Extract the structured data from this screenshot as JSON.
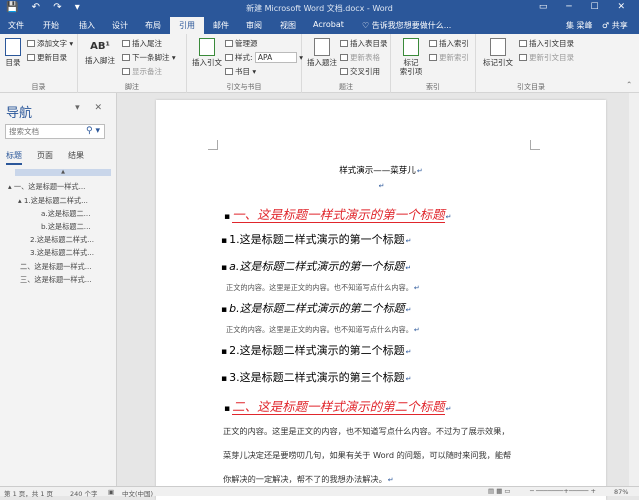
{
  "titlebar": {
    "quick_access": "💾 ↶ ↷ ▾",
    "document_title": "新建 Microsoft Word 文档.docx - Word",
    "window_controls": "▭ ─ ☐ ✕"
  },
  "tabs": [
    {
      "label": "文件"
    },
    {
      "label": "开始"
    },
    {
      "label": "插入"
    },
    {
      "label": "设计"
    },
    {
      "label": "布局"
    },
    {
      "label": "引用"
    },
    {
      "label": "邮件"
    },
    {
      "label": "审阅"
    },
    {
      "label": "视图"
    },
    {
      "label": "Acrobat"
    },
    {
      "label": "♡ 告诉我您想要做什么..."
    },
    {
      "label": "集 梁峰"
    },
    {
      "label": "♂ 共享"
    }
  ],
  "ribbon": {
    "toc": {
      "big": "目录",
      "add_text": "添加文字",
      "update": "更新目录",
      "label": "目录"
    },
    "footnotes": {
      "big": "插入脚注",
      "ab": "AB¹",
      "insert_endnote": "插入尾注",
      "next_footnote": "下一条脚注",
      "show_notes": "显示备注",
      "label": "脚注"
    },
    "citations": {
      "big": "插入引文",
      "manage": "管理源",
      "style_label": "样式:",
      "style_value": "APA",
      "bibliography": "书目",
      "label": "引文与书目"
    },
    "captions": {
      "big": "插入题注",
      "insert_toc_fig": "插入表目录",
      "update_table": "更新表格",
      "cross_ref": "交叉引用",
      "label": "题注"
    },
    "index": {
      "big": "标记\n索引项",
      "insert_index": "插入索引",
      "update_index": "更新索引",
      "label": "索引"
    },
    "authorities": {
      "big": "标记引文",
      "insert_toa": "插入引文目录",
      "update_toa": "更新引文目录",
      "label": "引文目录"
    }
  },
  "nav": {
    "title": "导航",
    "search_placeholder": "搜索文档",
    "tabs": [
      "标题",
      "页面",
      "结果"
    ],
    "items": [
      "▴ 一、这是标题一样式...",
      "▴ 1.这是标题二样式...",
      "a.这是标题二...",
      "b.这是标题二...",
      "2.这是标题二样式...",
      "3.这是标题二样式...",
      "二、这是标题一样式...",
      "三、这是标题一样式..."
    ]
  },
  "doc": {
    "heading": "样式演示——菜芽儿",
    "para_mark": "↵",
    "bullet": "▪",
    "lines": [
      "一、这是标题一样式演示的第一个标题",
      "1.这是标题二样式演示的第一个标题",
      "a.这是标题二样式演示的第一个标题",
      "正文的内容。这里是正文的内容。也不知道写点什么内容。",
      "b.这是标题二样式演示的第二个标题",
      "正文的内容。这里是正文的内容。也不知道写点什么内容。",
      "2.这是标题二样式演示的第二个标题",
      "3.这是标题二样式演示的第三个标题",
      "二、这是标题一样式演示的第二个标题",
      "正文的内容。这里是正文的内容，也不知道写点什么内容。不过为了展示效果，",
      "菜芽儿决定还是要唠叨几句，如果有关于 Word 的问题，可以随时来问我，能帮",
      "你解决的一定解决，帮不了的我想办法解决。"
    ]
  },
  "status": {
    "page": "第 1 页，共 1 页",
    "words": "240 个字",
    "language": "中文(中国)",
    "zoom": "87%"
  },
  "colors": {
    "accent": "#2b579a",
    "heading1": "#e0262c"
  }
}
